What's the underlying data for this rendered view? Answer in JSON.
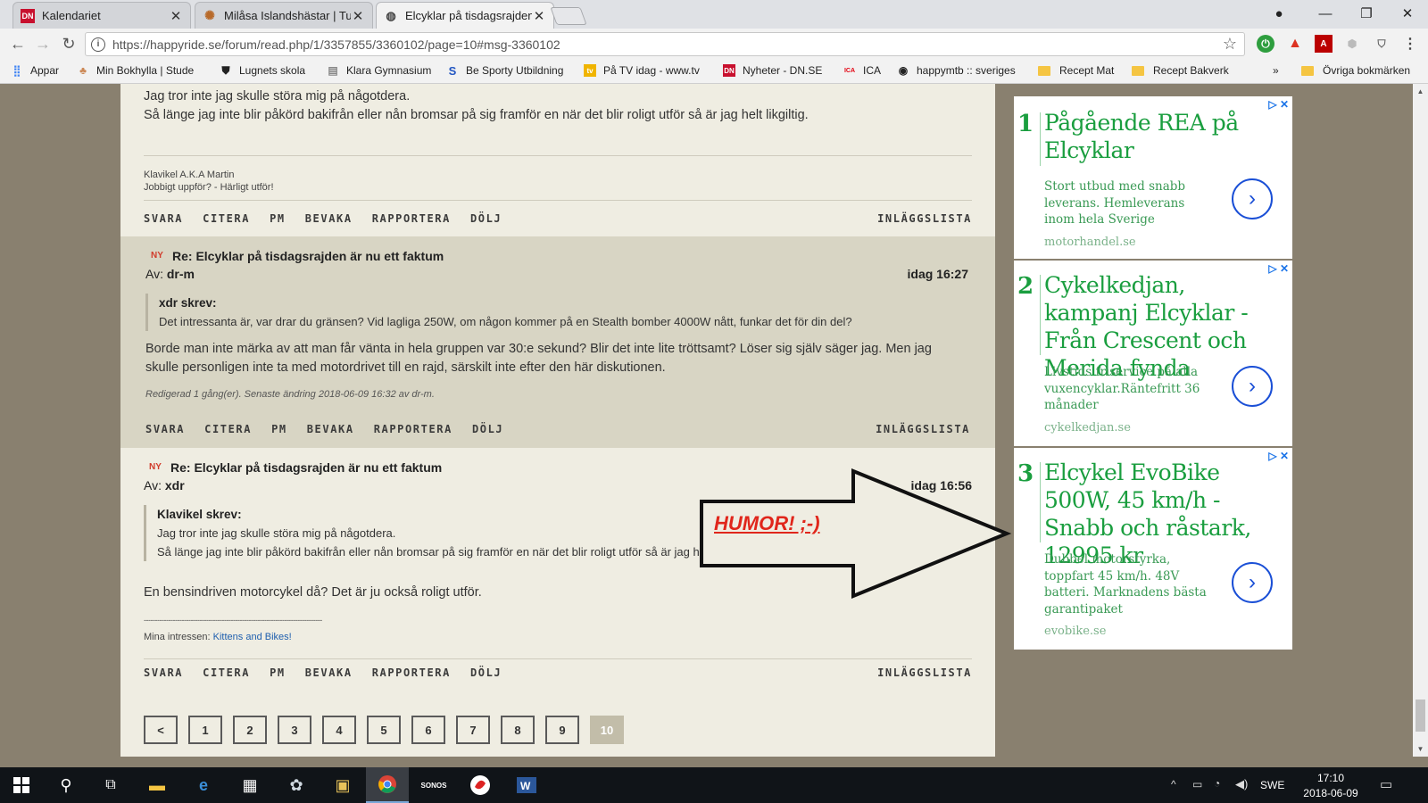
{
  "browser": {
    "tabs": [
      {
        "title": "Kalendariet",
        "favicon": "DN"
      },
      {
        "title": "Milåsa Islandshästar | Tur",
        "favicon": "sun"
      },
      {
        "title": "Elcyklar på tisdagsrajden",
        "favicon": "happyride"
      }
    ],
    "url": "https://happyride.se/forum/read.php/1/3357855/3360102/page=10#msg-3360102",
    "bookmarks": [
      {
        "label": "Appar",
        "favicon": "apps-grid"
      },
      {
        "label": "Min Bokhylla | Stude",
        "favicon": "bokhylla"
      },
      {
        "label": "Lugnets skola",
        "favicon": "shield"
      },
      {
        "label": "Klara Gymnasium",
        "favicon": "klara"
      },
      {
        "label": "Be Sporty Utbildning",
        "favicon": "S"
      },
      {
        "label": "På TV idag - www.tv",
        "favicon": "tv"
      },
      {
        "label": "Nyheter - DN.SE",
        "favicon": "DN"
      },
      {
        "label": "ICA",
        "favicon": "ICA"
      },
      {
        "label": "happymtb :: sveriges",
        "favicon": "happymtb"
      },
      {
        "label": "Recept Mat",
        "favicon": "folder"
      },
      {
        "label": "Recept Bakverk",
        "favicon": "folder"
      },
      {
        "label": "»",
        "favicon": ""
      },
      {
        "label": "Övriga bokmärken",
        "favicon": "folder"
      }
    ]
  },
  "post_prev": {
    "line1": "Jag tror inte jag skulle störa mig på någotdera.",
    "line2": "Så länge jag inte blir påkörd bakifrån eller nån bromsar på sig framför en när det blir roligt utför så är jag helt likgiltig.",
    "sig1": "Klavikel A.K.A Martin",
    "sig2": "Jobbigt uppför? - Härligt utför!"
  },
  "actions": [
    "SVARA",
    "CITERA",
    "PM",
    "BEVAKA",
    "RAPPORTERA",
    "DÖLJ"
  ],
  "actions_right": "INLÄGGSLISTA",
  "post1": {
    "badge": "NY",
    "title": "Re: Elcyklar på tisdagsrajden är nu ett faktum",
    "by_label": "Av:",
    "author": "dr-m",
    "date": "idag 16:27",
    "quote_head": "xdr skrev:",
    "quote_text": "Det intressanta är, var drar du gränsen? Vid lagliga 250W, om någon kommer på en Stealth bomber 4000W nått, funkar det för din del?",
    "body1": "Borde man inte märka av att man får vänta in hela gruppen var 30:e sekund? Blir det inte lite tröttsamt? Löser sig själv säger jag. Men jag",
    "body2": "skulle personligen inte ta med motordrivet till en rajd, särskilt inte efter den här diskutionen.",
    "edited": "Redigerad 1 gång(er). Senaste ändring 2018-06-09 16:32 av dr-m."
  },
  "post2": {
    "badge": "NY",
    "title": "Re: Elcyklar på tisdagsrajden är nu ett faktum",
    "by_label": "Av:",
    "author": "xdr",
    "date": "idag 16:56",
    "quote_head": "Klavikel skrev:",
    "quote_line1": "Jag tror inte jag skulle störa mig på någotdera.",
    "quote_line2": "Så länge jag inte blir påkörd bakifrån eller nån bromsar på sig framför en när det blir roligt utför så är jag helt likgiltig.",
    "body": "En bensindriven motorcykel då? Det är ju också roligt utför.",
    "sig_rule": "--------------------------------------------------------------------------------",
    "sig_prefix": "Mina intressen:",
    "sig_link": "Kittens and Bikes!"
  },
  "annotation": {
    "text": "HUMOR! ;-)"
  },
  "pager": [
    "<",
    "1",
    "2",
    "3",
    "4",
    "5",
    "6",
    "7",
    "8",
    "9",
    "10"
  ],
  "pager_current": "10",
  "ads": [
    {
      "num": "1",
      "head": "Pågående REA på Elcyklar",
      "desc": "Stort utbud med snabb leverans. Hemleverans inom hela Sverige",
      "domain": "motorhandel.se"
    },
    {
      "num": "2",
      "head": "Cykelkedjan, kampanj Elcyklar - Från Crescent och Merida fynda",
      "desc": "Livstids friservice på alla vuxencyklar.Räntefritt 36 månader",
      "domain": "cykelkedjan.se"
    },
    {
      "num": "3",
      "head": "Elcykel EvoBike 500W, 45 km/h - Snabb och råstark, 12995 kr",
      "desc": "Dubbel motorstyrka, toppfart 45 km/h. 48V batteri. Marknadens bästa garantipaket",
      "domain": "evobike.se"
    }
  ],
  "tray": {
    "lang": "SWE",
    "time": "17:10",
    "date": "2018-06-09"
  },
  "colors": {
    "page_bg": "#89806f",
    "post_bg": "#efede2",
    "post_alt_bg": "#d8d5c4",
    "ad_green": "#1a9e3f",
    "new_red": "#d13b2b",
    "humor_red": "#e0261b"
  }
}
